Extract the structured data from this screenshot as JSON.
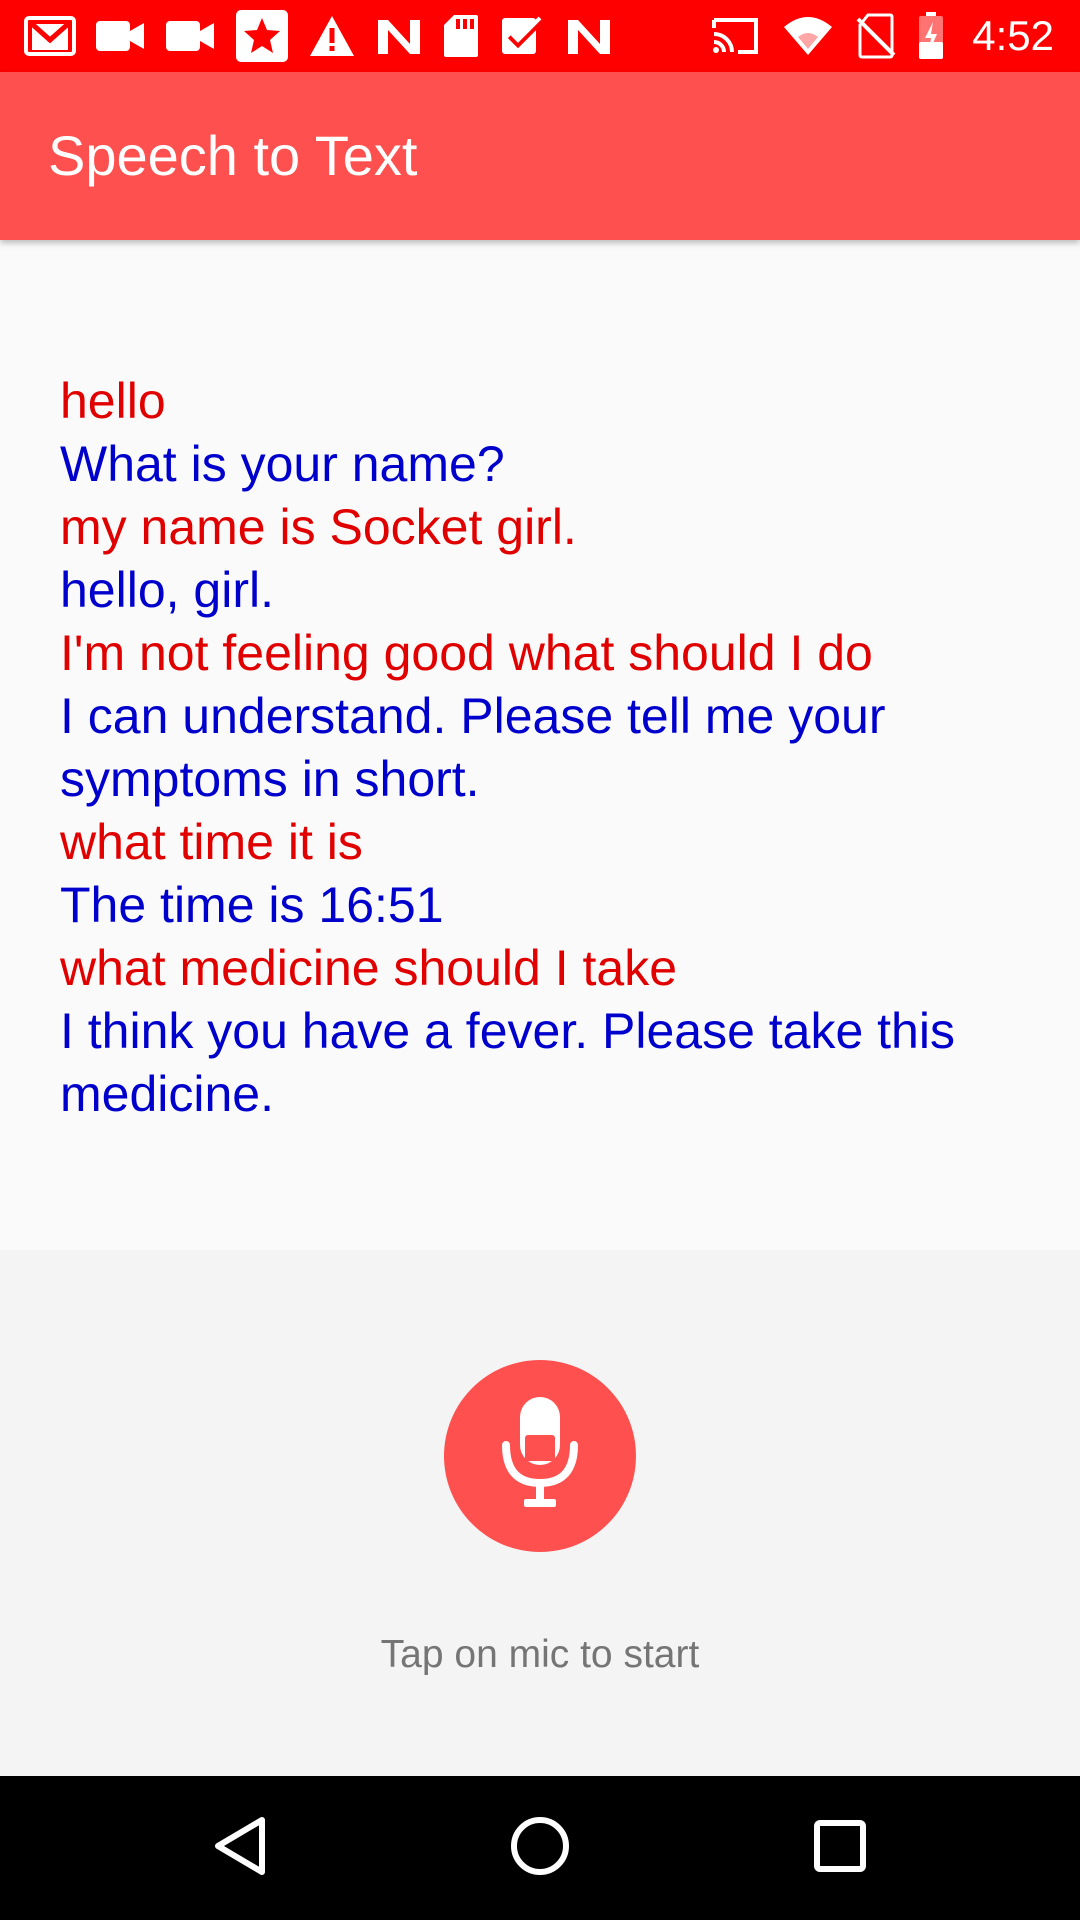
{
  "colors": {
    "status_bar": "#ff0000",
    "app_bar": "#ff5050",
    "user_text": "#e10000",
    "bot_text": "#0000cc",
    "mic_button": "#ff5050",
    "hint_text": "#757575"
  },
  "status_bar": {
    "time": "4:52",
    "left_icons": [
      "gmail-icon",
      "video-icon",
      "video-icon",
      "star-icon",
      "warning-icon",
      "n-app-icon",
      "sd-card-icon",
      "checkbox-icon",
      "n-app-icon"
    ],
    "right_icons": [
      "cast-icon",
      "wifi-icon",
      "no-sim-icon",
      "battery-charging-icon"
    ]
  },
  "app_bar": {
    "title": "Speech to Text"
  },
  "conversation": {
    "messages": [
      {
        "speaker": "user",
        "text": "hello"
      },
      {
        "speaker": "bot",
        "text": "What is your name?"
      },
      {
        "speaker": "user",
        "text": "my name is Socket girl."
      },
      {
        "speaker": "bot",
        "text": "hello, girl."
      },
      {
        "speaker": "user",
        "text": "I'm not feeling good what should I do"
      },
      {
        "speaker": "bot",
        "text": "I can understand.  Please tell me your symptoms in short."
      },
      {
        "speaker": "user",
        "text": "what time it is"
      },
      {
        "speaker": "bot",
        "text": "The time is 16:51"
      },
      {
        "speaker": "user",
        "text": "what medicine should I take"
      },
      {
        "speaker": "bot",
        "text": "I think you have a fever.  Please take this medicine."
      }
    ]
  },
  "mic": {
    "icon": "microphone-icon",
    "hint": "Tap on mic to start"
  },
  "nav_bar": {
    "buttons": [
      "back-icon",
      "home-icon",
      "recents-icon"
    ]
  }
}
